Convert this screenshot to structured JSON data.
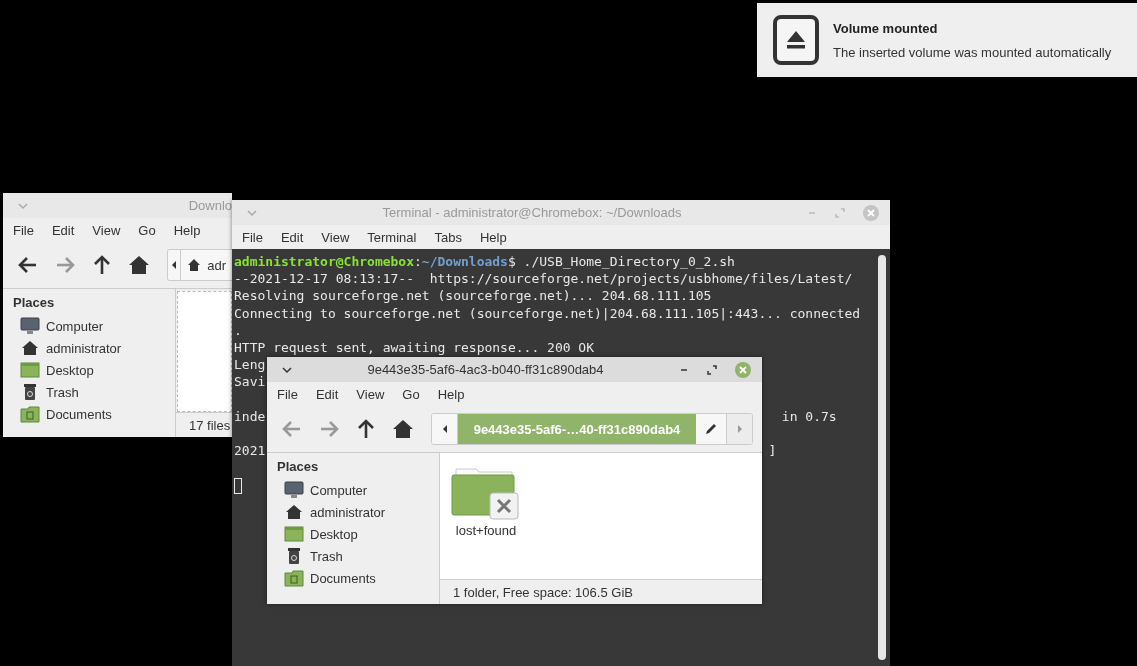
{
  "notification": {
    "title": "Volume mounted",
    "body": "The inserted volume was mounted automatically"
  },
  "back_window": {
    "title": "Downlo",
    "menu": [
      "File",
      "Edit",
      "View",
      "Go",
      "Help"
    ],
    "nav": [
      {
        "kind": "back",
        "disabled": false
      },
      {
        "kind": "forward",
        "disabled": true
      },
      {
        "kind": "up",
        "disabled": false
      },
      {
        "kind": "home",
        "disabled": false
      }
    ],
    "crumb": {
      "label": "adr",
      "selected": false
    },
    "places_heading": "Places",
    "places": [
      {
        "kind": "computer",
        "label": "Computer"
      },
      {
        "kind": "home",
        "label": "administrator"
      },
      {
        "kind": "desktop",
        "label": "Desktop"
      },
      {
        "kind": "trash",
        "label": "Trash"
      },
      {
        "kind": "documents",
        "label": "Documents"
      }
    ],
    "status": "17 files"
  },
  "terminal": {
    "title": "Terminal - administrator@Chromebox: ~/Downloads",
    "menu": [
      "File",
      "Edit",
      "View",
      "Terminal",
      "Tabs",
      "Help"
    ],
    "lines": [
      {
        "kind": "prompt",
        "user": "administrator@Chromebox",
        "sep": ":",
        "path": "~/Downloads",
        "command": "$ ./USB_Home_Directory_0_2.sh"
      },
      {
        "kind": "output",
        "text": "--2021-12-17 08:13:17--  https://sourceforge.net/projects/usbhome/files/Latest/"
      },
      {
        "kind": "output",
        "text": "Resolving sourceforge.net (sourceforge.net)... 204.68.111.105"
      },
      {
        "kind": "output",
        "text": "Connecting to sourceforge.net (sourceforge.net)|204.68.111.105|:443... connected"
      },
      {
        "kind": "output",
        "text": "."
      },
      {
        "kind": "output",
        "text": "HTTP request sent, awaiting response... 200 OK"
      },
      {
        "kind": "output",
        "text": "Leng"
      },
      {
        "kind": "output",
        "text": "Savi"
      },
      {
        "kind": "blank"
      },
      {
        "kind": "output",
        "text": "inde",
        "tail": "in 0.7s"
      },
      {
        "kind": "blank"
      },
      {
        "kind": "output",
        "text": "2021",
        "tail": "]"
      },
      {
        "kind": "blank"
      },
      {
        "kind": "cursor"
      }
    ]
  },
  "front_window": {
    "title": "9e443e35-5af6-4ac3-b040-ff31c890dab4",
    "menu": [
      "File",
      "Edit",
      "View",
      "Go",
      "Help"
    ],
    "nav": [
      {
        "kind": "back",
        "disabled": true
      },
      {
        "kind": "forward",
        "disabled": true
      },
      {
        "kind": "up",
        "disabled": false
      },
      {
        "kind": "home",
        "disabled": false
      }
    ],
    "crumb": {
      "label": "9e443e35-5af6-…40-ff31c890dab4",
      "selected": true
    },
    "places_heading": "Places",
    "places": [
      {
        "kind": "computer",
        "label": "Computer"
      },
      {
        "kind": "home",
        "label": "administrator"
      },
      {
        "kind": "desktop",
        "label": "Desktop"
      },
      {
        "kind": "trash",
        "label": "Trash"
      },
      {
        "kind": "documents",
        "label": "Documents"
      }
    ],
    "files": [
      {
        "kind": "folder",
        "name": "lost+found",
        "readable": false
      }
    ],
    "status": "1 folder, Free space: 106.5 GiB"
  }
}
